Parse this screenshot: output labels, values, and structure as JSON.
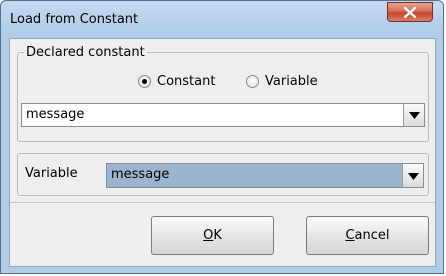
{
  "window": {
    "title": "Load from Constant"
  },
  "declared": {
    "legend": "Declared constant",
    "radio_constant": "Constant",
    "radio_variable": "Variable",
    "selected": "Constant",
    "combo_value": "message"
  },
  "variable": {
    "label": "Variable",
    "combo_value": "message"
  },
  "buttons": {
    "ok_mnemonic": "O",
    "ok_rest": "K",
    "cancel_mnemonic": "C",
    "cancel_rest": "ancel"
  },
  "icons": {
    "close": "close-x-icon",
    "dropdown": "triangle-down-icon"
  },
  "colors": {
    "title_gradient_top": "#c5dbf1",
    "close_red": "#c2452b",
    "dialog_bg": "#eeeeee",
    "variable_combo_bg": "#9db4ce"
  }
}
